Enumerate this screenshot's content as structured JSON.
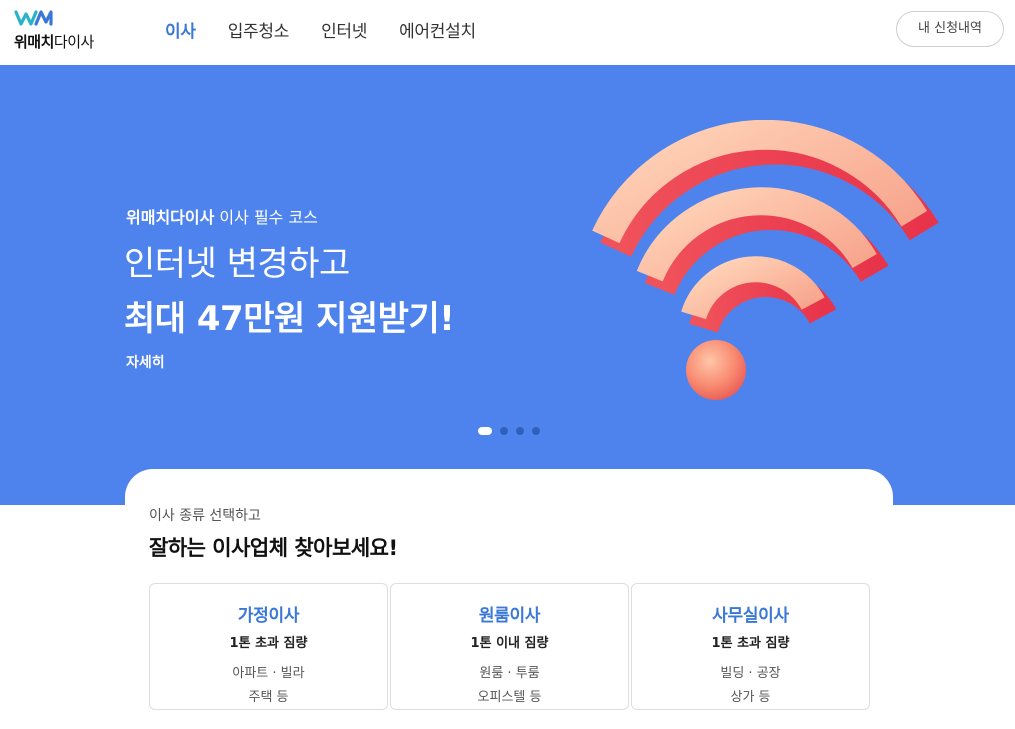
{
  "header": {
    "logo_bold": "위매치",
    "logo_rest": "다이사",
    "nav": [
      "이사",
      "입주청소",
      "인터넷",
      "에어컨설치"
    ],
    "active_nav": "이사",
    "my_button": "내 신청내역"
  },
  "banner": {
    "sub_bold": "위매치다이사",
    "sub_rest": " 이사 필수 코스",
    "title1": "인터넷 변경하고",
    "title2": "최대 47만원 지원받기!",
    "link": "자세히",
    "slides": 4,
    "active_slide": 1,
    "bg_color": "#4e83ee"
  },
  "section": {
    "sub": "이사 종류 선택하고",
    "title": "잘하는 이사업체 찾아보세요!",
    "types": [
      {
        "name": "가정이사",
        "load": "1톤 초과 짐량",
        "desc1": "아파트 · 빌라",
        "desc2": "주택 등"
      },
      {
        "name": "원룸이사",
        "load": "1톤 이내 짐량",
        "desc1": "원룸 · 투룸",
        "desc2": "오피스텔 등"
      },
      {
        "name": "사무실이사",
        "load": "1톤 초과 짐량",
        "desc1": "빌딩 · 공장",
        "desc2": "상가 등"
      }
    ]
  },
  "colors": {
    "accent": "#3a78d8",
    "banner": "#4e83ee"
  }
}
